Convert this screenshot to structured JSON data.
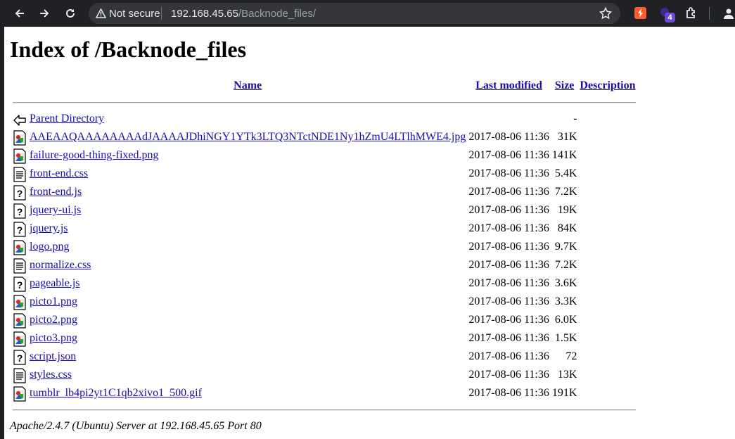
{
  "browser": {
    "security_label": "Not secure",
    "url_host": "192.168.45.65",
    "url_path": "/Backnode_files/",
    "extension_badge": "4"
  },
  "page": {
    "title": "Index of /Backnode_files",
    "headers": {
      "name": "Name",
      "modified": "Last modified",
      "size": "Size",
      "description": "Description"
    },
    "parent": {
      "name": "Parent Directory",
      "size": "-"
    },
    "files": [
      {
        "icon": "image",
        "name": "AAEAAQAAAAAAAAdJAAAAJDhiNGY1YTk3LTQ3NTctNDE1Ny1hZmU4LTlhMWE4.jpg",
        "modified": "2017-08-06 11:36",
        "size": "31K"
      },
      {
        "icon": "image",
        "name": "failure-good-thing-fixed.png",
        "modified": "2017-08-06 11:36",
        "size": "141K"
      },
      {
        "icon": "text",
        "name": "front-end.css",
        "modified": "2017-08-06 11:36",
        "size": "5.4K"
      },
      {
        "icon": "unknown",
        "name": "front-end.js",
        "modified": "2017-08-06 11:36",
        "size": "7.2K"
      },
      {
        "icon": "unknown",
        "name": "jquery-ui.js",
        "modified": "2017-08-06 11:36",
        "size": "19K"
      },
      {
        "icon": "unknown",
        "name": "jquery.js",
        "modified": "2017-08-06 11:36",
        "size": "84K"
      },
      {
        "icon": "image",
        "name": "logo.png",
        "modified": "2017-08-06 11:36",
        "size": "9.7K"
      },
      {
        "icon": "text",
        "name": "normalize.css",
        "modified": "2017-08-06 11:36",
        "size": "7.2K"
      },
      {
        "icon": "unknown",
        "name": "pageable.js",
        "modified": "2017-08-06 11:36",
        "size": "3.6K"
      },
      {
        "icon": "image",
        "name": "picto1.png",
        "modified": "2017-08-06 11:36",
        "size": "3.3K"
      },
      {
        "icon": "image",
        "name": "picto2.png",
        "modified": "2017-08-06 11:36",
        "size": "6.0K"
      },
      {
        "icon": "image",
        "name": "picto3.png",
        "modified": "2017-08-06 11:36",
        "size": "1.5K"
      },
      {
        "icon": "unknown",
        "name": "script.json",
        "modified": "2017-08-06 11:36",
        "size": "72"
      },
      {
        "icon": "text",
        "name": "styles.css",
        "modified": "2017-08-06 11:36",
        "size": "13K"
      },
      {
        "icon": "image",
        "name": "tumblr_lb4pi2yt1C1qb2xivo1_500.gif",
        "modified": "2017-08-06 11:36",
        "size": "191K"
      }
    ],
    "footer": "Apache/2.4.7 (Ubuntu) Server at 192.168.45.65 Port 80"
  },
  "colors": {
    "chrome_bg": "#202124",
    "omnibox_bg": "#35363a",
    "link": "#1a0dab"
  }
}
